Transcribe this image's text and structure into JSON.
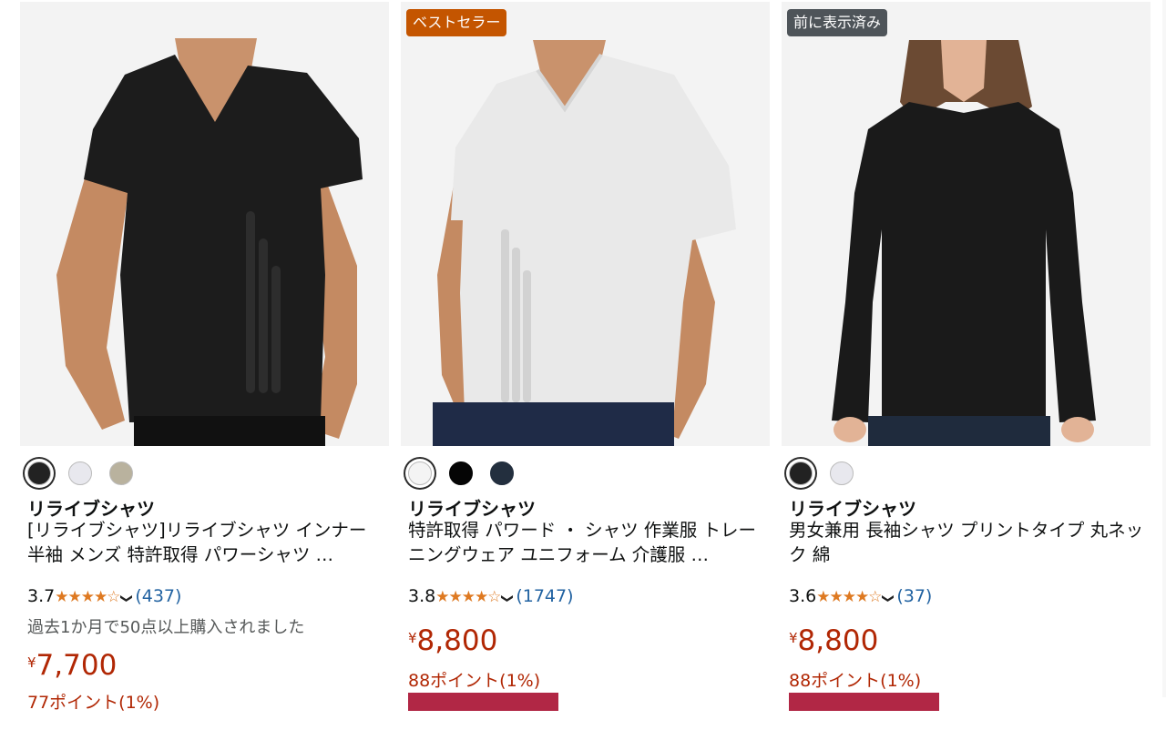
{
  "products": [
    {
      "badge": "",
      "brand": "リライブシャツ",
      "title": "[リライブシャツ]リライブシャツ インナー 半袖 メンズ 特許取得 パワーシャツ …",
      "rating": "3.7",
      "stars": "★★★★☆",
      "review_count": "(437)",
      "bought_text": "過去1か月で50点以上購入されました",
      "price_currency": "¥",
      "price": "7,700",
      "points": "77ポイント(1%)",
      "colors": [
        "#222222",
        "#e8e8ee",
        "#b9b29e"
      ]
    },
    {
      "badge": "ベストセラー",
      "brand": "リライブシャツ",
      "title": "特許取得 パワード ・ シャツ 作業服 トレーニングウェア ユニフォーム 介護服 …",
      "rating": "3.8",
      "stars": "★★★★☆",
      "review_count": "(1747)",
      "bought_text": "",
      "price_currency": "¥",
      "price": "8,800",
      "points": "88ポイント(1%)",
      "colors": [
        "#f4f4f4",
        "#050505",
        "#232f3e"
      ]
    },
    {
      "badge": "前に表示済み",
      "brand": "リライブシャツ",
      "title": "男女兼用 長袖シャツ プリントタイプ 丸ネック 綿",
      "rating": "3.6",
      "stars": "★★★★☆",
      "review_count": "(37)",
      "bought_text": "",
      "price_currency": "¥",
      "price": "8,800",
      "points": "88ポイント(1%)",
      "colors": [
        "#222222",
        "#e8e8ee"
      ]
    }
  ],
  "icons": {
    "rating_chevron": "chevron-down-icon",
    "star": "star-icon"
  },
  "colors": {
    "price": "#b12704",
    "star": "#de7921",
    "link": "#2162a1",
    "bestseller_badge": "#c45500",
    "viewed_badge": "#4e5459"
  }
}
